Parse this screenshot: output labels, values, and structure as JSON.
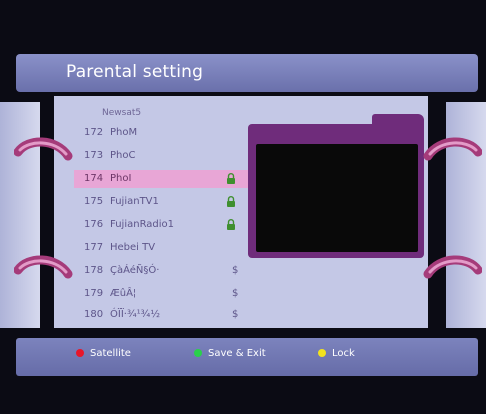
{
  "title": "Parental setting",
  "satellite_name": "Newsat5",
  "channels": [
    {
      "num": "172",
      "name": "PhoM",
      "icon": "",
      "selected": false
    },
    {
      "num": "173",
      "name": "PhoC",
      "icon": "",
      "selected": false
    },
    {
      "num": "174",
      "name": "PhoI",
      "icon": "lock-icon",
      "selected": true
    },
    {
      "num": "175",
      "name": "FujianTV1",
      "icon": "lock-icon",
      "selected": false
    },
    {
      "num": "176",
      "name": "FujianRadio1",
      "icon": "lock-icon",
      "selected": false
    },
    {
      "num": "177",
      "name": "Hebei TV",
      "icon": "",
      "selected": false
    },
    {
      "num": "178",
      "name": "ÇàÁéÑ§Ó·",
      "icon": "$",
      "selected": false
    },
    {
      "num": "179",
      "name": "ÆûÂ¦",
      "icon": "$",
      "selected": false
    },
    {
      "num": "180",
      "name": "ÓÏÏ·¾¹¾½",
      "icon": "$",
      "selected": false
    }
  ],
  "footer": {
    "satellite_label": "Satellite",
    "save_exit_label": "Save & Exit",
    "lock_label": "Lock"
  },
  "colors": {
    "red_key": "#e8162a",
    "green_key": "#29d14a",
    "yellow_key": "#f2e21e",
    "lock_green": "#3f8f2f",
    "preview_frame": "#6f2c7b"
  }
}
